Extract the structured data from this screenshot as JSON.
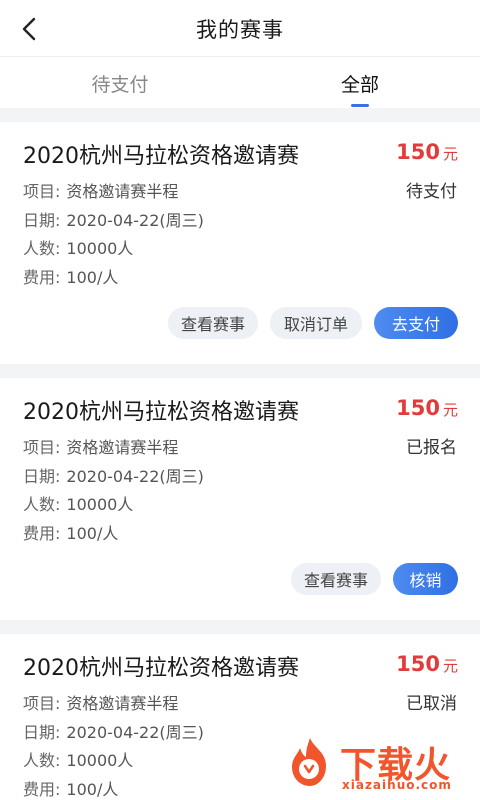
{
  "header": {
    "title": "我的赛事"
  },
  "tabs": [
    {
      "label": "待支付"
    },
    {
      "label": "全部"
    }
  ],
  "cards": [
    {
      "title": "2020杭州马拉松资格邀请赛",
      "price": "150",
      "price_unit": "元",
      "status": "待支付",
      "project_label": "项目:",
      "project": "资格邀请赛半程",
      "date_label": "日期:",
      "date": "2020-04-22(周三)",
      "people_label": "人数:",
      "people": "10000人",
      "fee_label": "费用:",
      "fee": "100/人",
      "buttons": [
        "查看赛事",
        "取消订单",
        "去支付"
      ]
    },
    {
      "title": "2020杭州马拉松资格邀请赛",
      "price": "150",
      "price_unit": "元",
      "status": "已报名",
      "project_label": "项目:",
      "project": "资格邀请赛半程",
      "date_label": "日期:",
      "date": "2020-04-22(周三)",
      "people_label": "人数:",
      "people": "10000人",
      "fee_label": "费用:",
      "fee": "100/人",
      "buttons": [
        "查看赛事",
        "核销"
      ]
    },
    {
      "title": "2020杭州马拉松资格邀请赛",
      "price": "150",
      "price_unit": "元",
      "status": "已取消",
      "project_label": "项目:",
      "project": "资格邀请赛半程",
      "date_label": "日期:",
      "date": "2020-04-22(周三)",
      "people_label": "人数:",
      "people": "10000人",
      "fee_label": "费用:",
      "fee": "100/人"
    }
  ],
  "watermark": {
    "text": "下载火",
    "sub": "xiazaihuo.com"
  },
  "colors": {
    "accent": "#3a73e8",
    "price": "#e23b3b",
    "watermark": "#f2552c"
  }
}
